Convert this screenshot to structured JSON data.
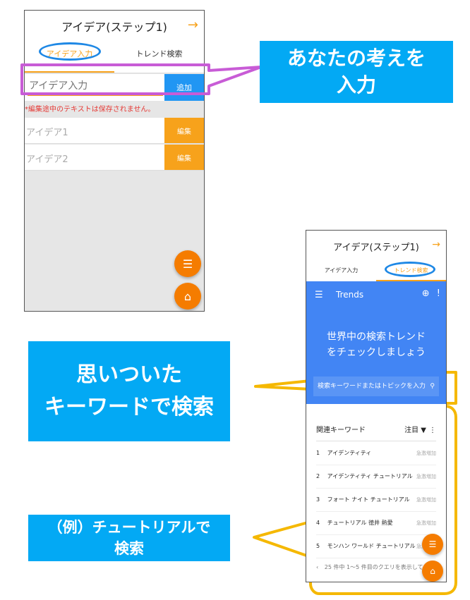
{
  "screen1": {
    "title": "アイデア(ステップ1)",
    "arrow": "→",
    "tabs": [
      "アイデア入力",
      "トレンド検索"
    ],
    "input_placeholder": "アイデア入力",
    "add_label": "追加",
    "warning": "*編集途中のテキストは保存されません。",
    "ideas": [
      {
        "text": "アイデア1",
        "edit": "編集"
      },
      {
        "text": "アイデア2",
        "edit": "編集"
      }
    ]
  },
  "callouts": {
    "enter": [
      "あなたの考えを",
      "入力"
    ],
    "search": [
      "思いついた",
      "キーワードで検索"
    ],
    "example": [
      "（例）チュートリアルで",
      "検索"
    ]
  },
  "screen2": {
    "title": "アイデア(ステップ1)",
    "arrow": "→",
    "tabs": [
      "アイデア入力",
      "トレンド検索"
    ],
    "trends_label": "Trends",
    "headline": [
      "世界中の検索トレンド",
      "をチェックしましょう"
    ],
    "search_placeholder": "検索キーワードまたはトピックを入力",
    "related_title": "関連キーワード",
    "related_sort": "注目",
    "related": [
      {
        "rank": "1",
        "term": "アイデンティティ",
        "badge": "急激増加"
      },
      {
        "rank": "2",
        "term": "アイデンティティ チュートリアル",
        "badge": "急激増加"
      },
      {
        "rank": "3",
        "term": "フォート ナイト チュートリアル",
        "badge": "急激増加"
      },
      {
        "rank": "4",
        "term": "チュートリアル 徳井 熱愛",
        "badge": "急激増加"
      },
      {
        "rank": "5",
        "term": "モンハン ワールド チュートリアル",
        "badge": "急激増加"
      }
    ],
    "footer": "25 件中 1〜5 件目のクエリを表示して"
  },
  "colors": {
    "accent_orange": "#f7a21b",
    "accent_blue": "#2196f3",
    "trends_blue": "#4285f4",
    "callout_blue": "#03a9f4",
    "highlight_purple": "#c85cd6",
    "highlight_blue": "#1e88e5",
    "highlight_yellow": "#f5b800"
  }
}
